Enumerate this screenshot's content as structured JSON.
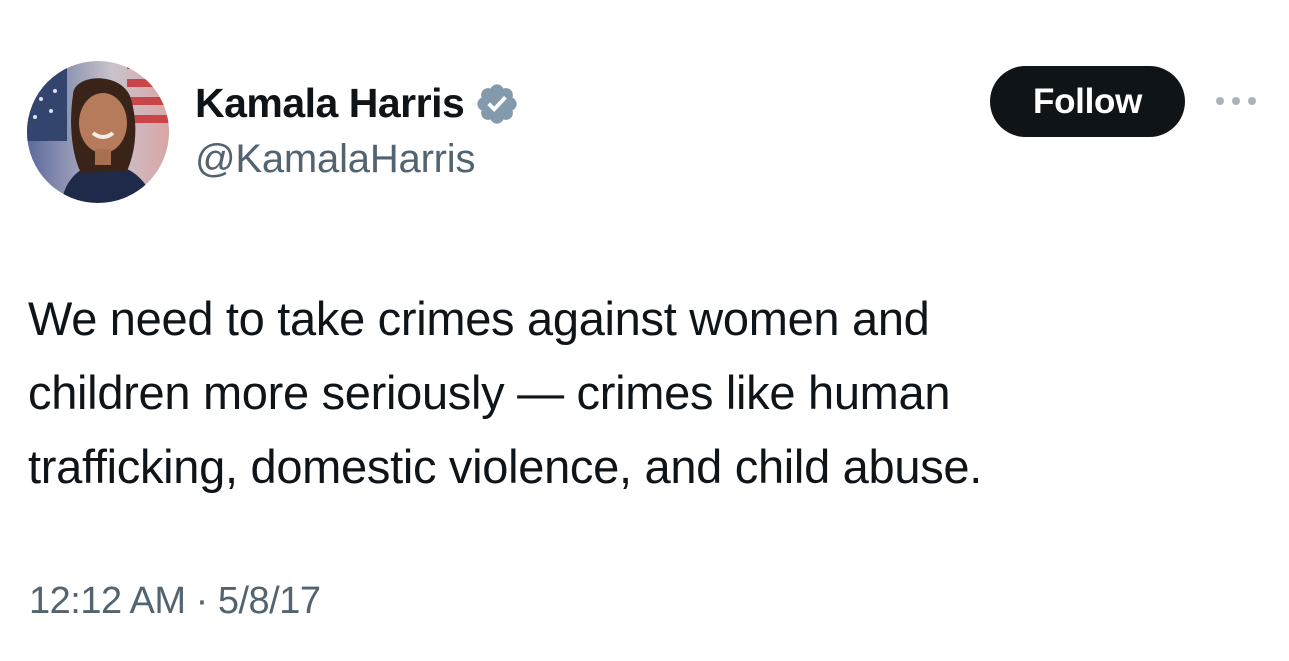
{
  "author": {
    "display_name": "Kamala Harris",
    "handle": "@KamalaHarris",
    "verified": true,
    "avatar_icon": "profile-photo"
  },
  "actions": {
    "follow_label": "Follow",
    "more_icon": "more-horizontal-icon"
  },
  "tweet": {
    "text": "We need to take crimes against women and\nchildren more seriously — crimes like human\ntrafficking, domestic violence, and child abuse.",
    "timestamp": "12:12 AM · 5/8/17"
  },
  "colors": {
    "text_primary": "#0f1419",
    "text_secondary": "#536471",
    "follow_bg": "#0f1419",
    "verified_badge": "#829aab"
  }
}
